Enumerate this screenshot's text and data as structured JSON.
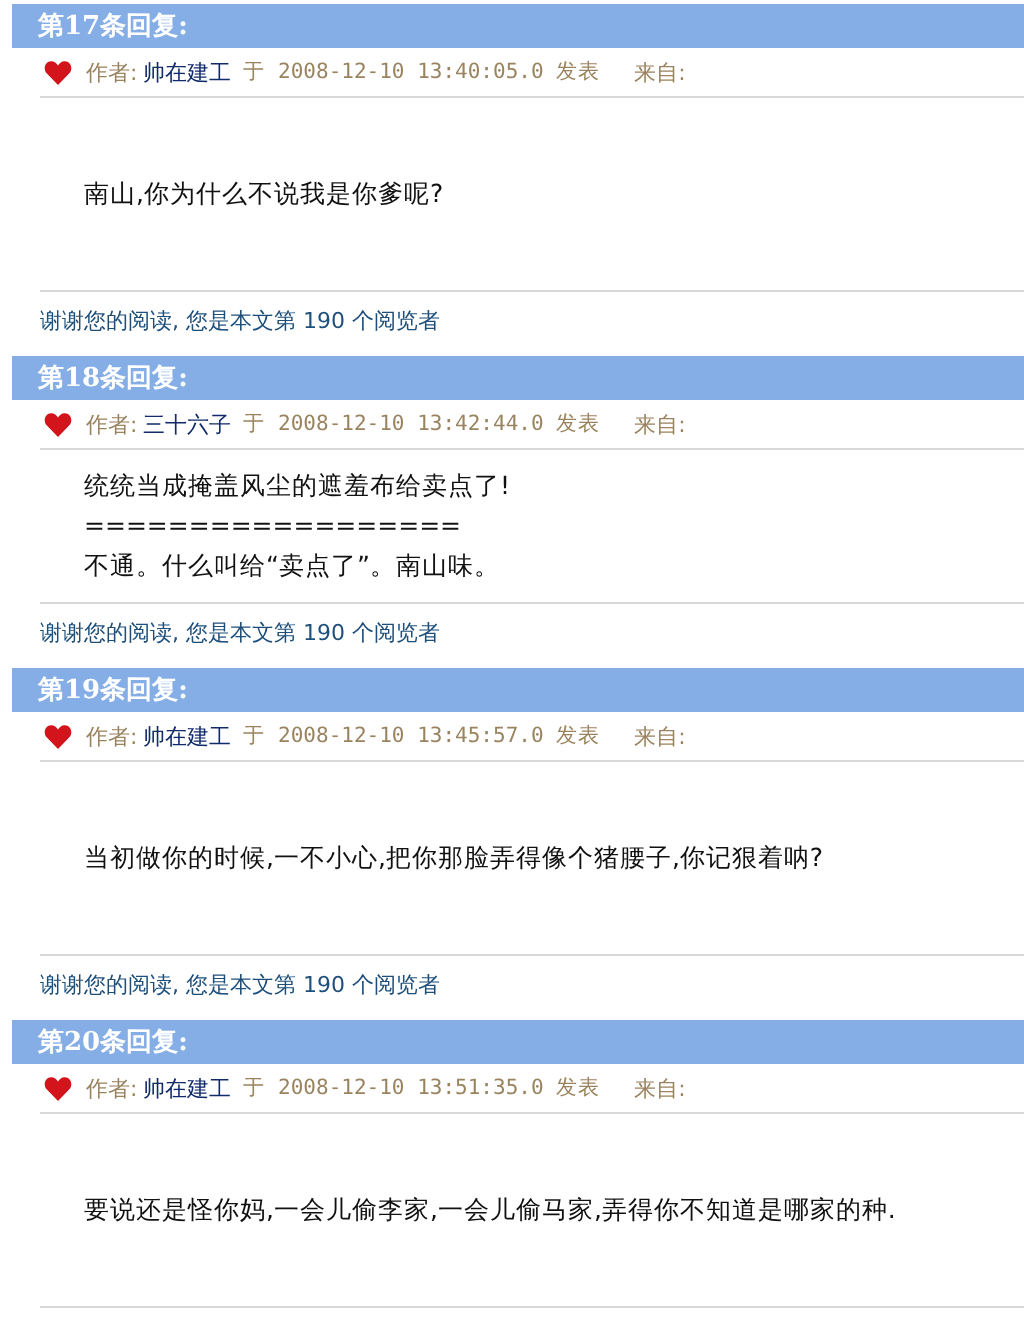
{
  "replies": [
    {
      "title": "第17条回复:",
      "author_label": "作者:",
      "author": "帅在建工",
      "posted": "于 2008-12-10 13:40:05.0 发表",
      "from_label": "来自:",
      "lines": [
        "南山,你为什么不说我是你爹呢?"
      ],
      "footer": "谢谢您的阅读, 您是本文第 190 个阅览者"
    },
    {
      "title": "第18条回复:",
      "author_label": "作者:",
      "author": "三十六子",
      "posted": "于 2008-12-10 13:42:44.0 发表",
      "from_label": "来自:",
      "lines": [
        "统统当成掩盖风尘的遮羞布给卖点了!",
        "==================",
        "不通。什么叫给“卖点了”。南山味。"
      ],
      "footer": "谢谢您的阅读, 您是本文第 190 个阅览者"
    },
    {
      "title": "第19条回复:",
      "author_label": "作者:",
      "author": "帅在建工",
      "posted": "于 2008-12-10 13:45:57.0 发表",
      "from_label": "来自:",
      "lines": [
        "当初做你的时候,一不小心,把你那脸弄得像个猪腰子,你记狠着呐?"
      ],
      "footer": "谢谢您的阅读, 您是本文第 190 个阅览者"
    },
    {
      "title": "第20条回复:",
      "author_label": "作者:",
      "author": "帅在建工",
      "posted": "于 2008-12-10 13:51:35.0 发表",
      "from_label": "来自:",
      "lines": [
        "要说还是怪你妈,一会儿偷李家,一会儿偷马家,弄得你不知道是哪家的种."
      ]
    }
  ]
}
